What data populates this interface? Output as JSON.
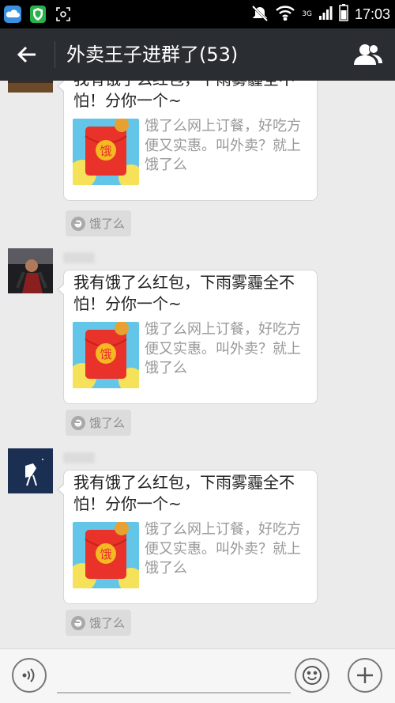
{
  "status_bar": {
    "time": "17:03",
    "network": "3G",
    "icons": [
      "cloud-icon",
      "shield-icon",
      "screenshot-icon",
      "mute-icon",
      "wifi-icon",
      "signal-icon",
      "battery-icon"
    ]
  },
  "header": {
    "title": "外卖王子进群了(53)",
    "back_icon": "arrow-left-icon",
    "contacts_icon": "group-members-icon"
  },
  "messages": [
    {
      "title": "我有饿了么红包，下雨雾霾全不怕！分你一个~",
      "description": "饿了么网上订餐，好吃方便又实惠。叫外卖？就上饿了么",
      "thumb_text": "饿",
      "source": "饿了么"
    },
    {
      "title": "我有饿了么红包，下雨雾霾全不怕！分你一个~",
      "description": "饿了么网上订餐，好吃方便又实惠。叫外卖？就上饿了么",
      "thumb_text": "饿",
      "source": "饿了么"
    },
    {
      "title": "我有饿了么红包，下雨雾霾全不怕！分你一个~",
      "description": "饿了么网上订餐，好吃方便又实惠。叫外卖？就上饿了么",
      "thumb_text": "饿",
      "source": "饿了么"
    }
  ],
  "input_bar": {
    "placeholder": "",
    "icons": [
      "voice-icon",
      "emoji-icon",
      "plus-icon"
    ]
  },
  "colors": {
    "header_bg": "#2a2d31",
    "chat_bg": "#ebebeb",
    "red_packet": "#e8322a",
    "coin": "#f5b921",
    "thumb_bg": "#63c6e8"
  }
}
